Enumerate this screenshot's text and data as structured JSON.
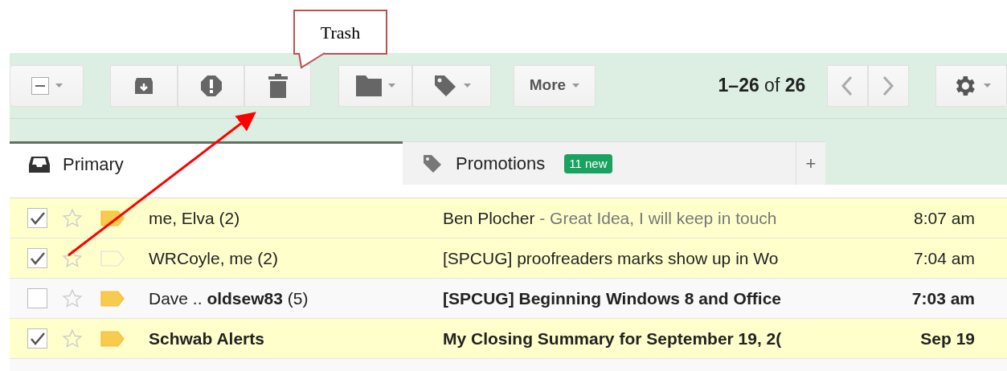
{
  "callout": {
    "text": "Trash"
  },
  "toolbar": {
    "select_all": {
      "indeterminate": true
    },
    "more_button": "More",
    "page_range": "**1–26** of **26**"
  },
  "tabs": [
    {
      "label": "Primary",
      "selected": true,
      "kind": "inbox"
    },
    {
      "label": "Promotions",
      "selected": false,
      "kind": "tag",
      "badge": "11 new"
    },
    {
      "label": "+",
      "selected": false,
      "kind": "add"
    }
  ],
  "rows": [
    {
      "checked": true,
      "starred": false,
      "important": true,
      "unread": false,
      "sender_bold": false,
      "sender": "me, Elva (2)",
      "subject": "Ben Plocher",
      "snippet": " - Great Idea, I will keep in touch",
      "time": "8:07 am"
    },
    {
      "checked": true,
      "starred": false,
      "important": false,
      "unread": false,
      "sender_bold": false,
      "sender": "WRCoyle, me (2)",
      "subject": "[SPCUG] proofreaders marks show up in Wo",
      "time": "7:04 am"
    },
    {
      "checked": false,
      "starred": false,
      "important": true,
      "unread": true,
      "sender_bold": false,
      "sender": "Dave .. **oldsew83** (5)",
      "subject": "[SPCUG] Beginning Windows 8 and Office",
      "time": "7:03 am"
    },
    {
      "checked": true,
      "starred": false,
      "important": true,
      "unread": true,
      "sender_bold": true,
      "sender": "Schwab Alerts",
      "subject": "My Closing Summary for September 19, 2(",
      "time": "Sep 19"
    }
  ]
}
